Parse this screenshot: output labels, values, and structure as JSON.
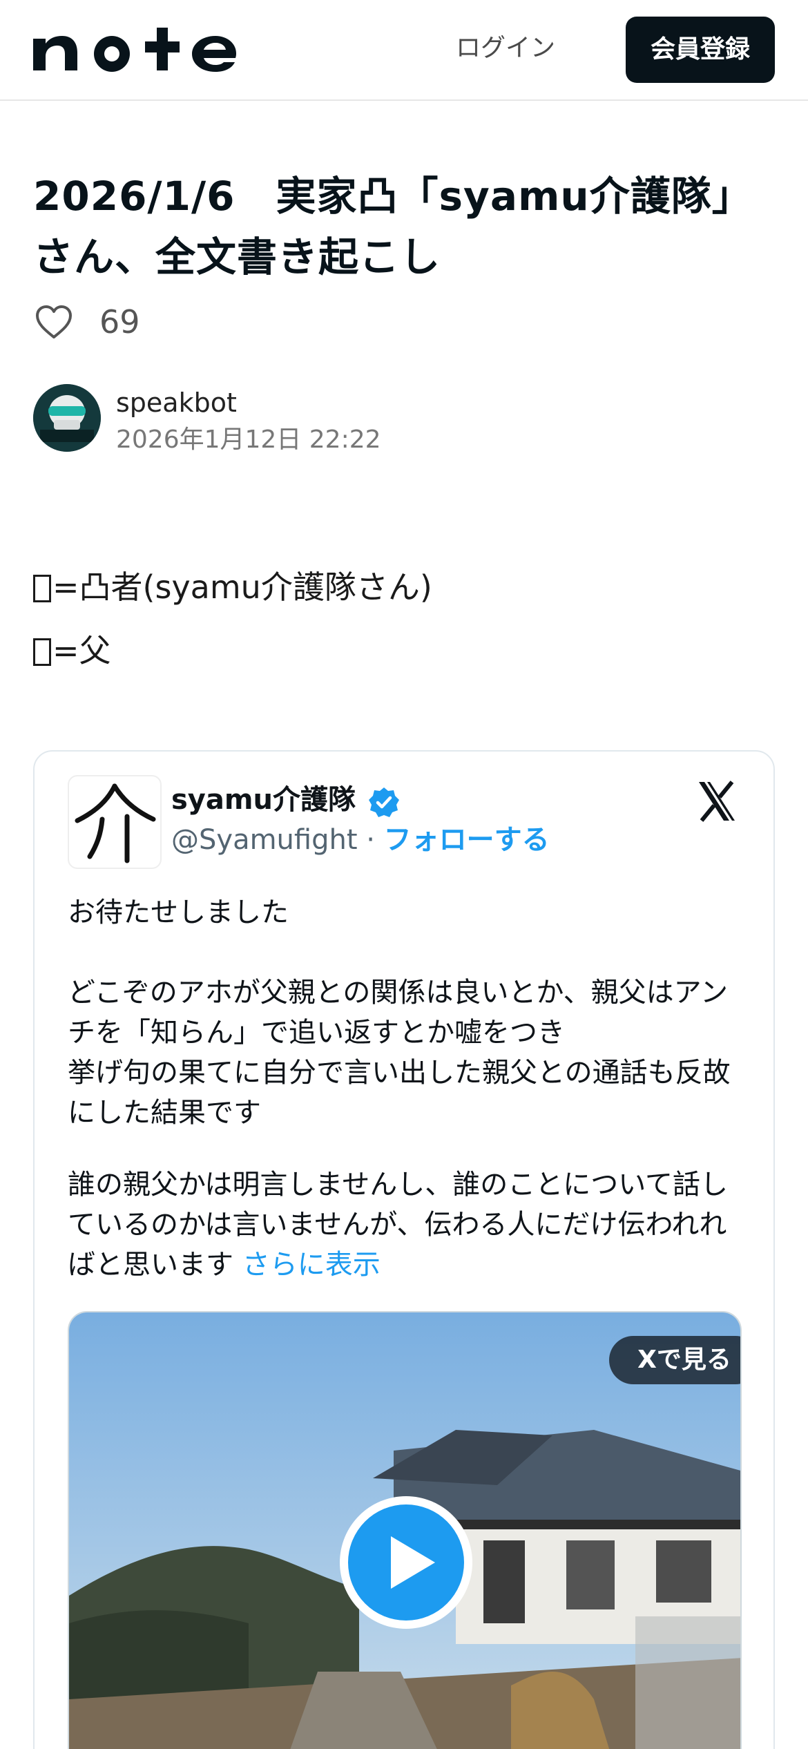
{
  "header": {
    "login_label": "ログイン",
    "signup_label": "会員登録",
    "logo_icon": "note-logo"
  },
  "article": {
    "title": "2026/1/6　実家凸「syamu介護隊」さん、全文書き起こし",
    "like_count": "69",
    "author": "speakbot",
    "date": "2026年1月12日 22:22",
    "lines": [
      "=凸者(syamu介護隊さん)",
      "=父"
    ]
  },
  "tweet": {
    "name": "syamu介護隊",
    "handle": "@Syamufight",
    "separator": " · ",
    "follow_label": "フォローする",
    "paragraphs": [
      "お待たせしました",
      "どこぞのアホが父親との関係は良いとか、親父はアンチを「知らん」で追い返すとか嘘をつき",
      "挙げ句の果てに自分で言い出した親父との通話も反故にした結果です",
      "誰の親父かは明言しませんし、誰のことについて話しているのかは言いませんが、伝わる人にだけ伝われればと思います"
    ],
    "more_label": "さらに表示",
    "view_on_x_label": "Xで見る",
    "accent_color": "#1d9bf0"
  }
}
